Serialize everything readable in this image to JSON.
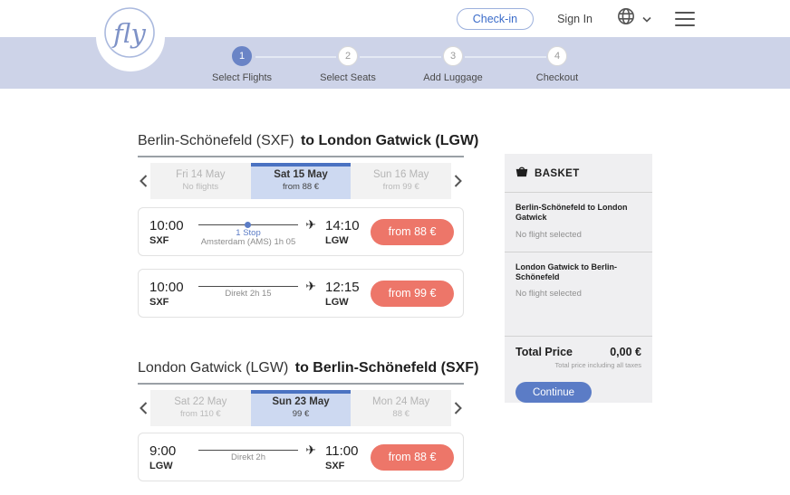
{
  "header": {
    "logo_text": "fly",
    "checkin_label": "Check-in",
    "signin_label": "Sign In"
  },
  "stepper": {
    "steps": [
      {
        "number": "1",
        "label": "Select Flights",
        "active": true
      },
      {
        "number": "2",
        "label": "Select Seats",
        "active": false
      },
      {
        "number": "3",
        "label": "Add Luggage",
        "active": false
      },
      {
        "number": "4",
        "label": "Checkout",
        "active": false
      }
    ]
  },
  "sections": [
    {
      "title_regular": "Berlin-Schönefeld (SXF)",
      "title_bold": "to London Gatwick (LGW)",
      "dates": [
        {
          "day": "Fri 14 May",
          "price": "No flights",
          "state": "inactive"
        },
        {
          "day": "Sat 15 May",
          "price": "from 88 €",
          "state": "active"
        },
        {
          "day": "Sun 16 May",
          "price": "from 99 €",
          "state": "inactive"
        }
      ],
      "flights": [
        {
          "dep_time": "10:00",
          "dep_code": "SXF",
          "arr_time": "14:10",
          "arr_code": "LGW",
          "stop_label": "1 Stop",
          "detail": "Amsterdam (AMS) 1h 05",
          "price": "from 88 €"
        },
        {
          "dep_time": "10:00",
          "dep_code": "SXF",
          "arr_time": "12:15",
          "arr_code": "LGW",
          "stop_label": "",
          "detail": "Direkt 2h 15",
          "price": "from 99 €"
        }
      ]
    },
    {
      "title_regular": "London Gatwick (LGW)",
      "title_bold": "to Berlin-Schönefeld (SXF)",
      "dates": [
        {
          "day": "Sat 22 May",
          "price": "from 110 €",
          "state": "inactive"
        },
        {
          "day": "Sun 23 May",
          "price": "99 €",
          "state": "active"
        },
        {
          "day": "Mon 24 May",
          "price": "88 €",
          "state": "inactive"
        }
      ],
      "flights": [
        {
          "dep_time": "9:00",
          "dep_code": "LGW",
          "arr_time": "11:00",
          "arr_code": "SXF",
          "stop_label": "",
          "detail": "Direkt 2h",
          "price": "from 88 €"
        }
      ]
    }
  ],
  "basket": {
    "title": "BASKET",
    "items": [
      {
        "route": "Berlin-Schönefeld to London Gatwick",
        "status": "No flight selected"
      },
      {
        "route": "London Gatwick  to Berlin-Schönefeld",
        "status": "No flight selected"
      }
    ],
    "total_label": "Total Price",
    "total_value": "0,00 €",
    "total_note": "Total price including all taxes",
    "continue_label": "Continue"
  },
  "icons": {
    "plane": "✈"
  },
  "colors": {
    "band": "#cdd3e8",
    "accent": "#5b7cc6",
    "accent_dark": "#4a72c2",
    "step_active": "#6a84c6",
    "coral": "#ed7669",
    "tab_active_bg": "#cdd9f1"
  }
}
